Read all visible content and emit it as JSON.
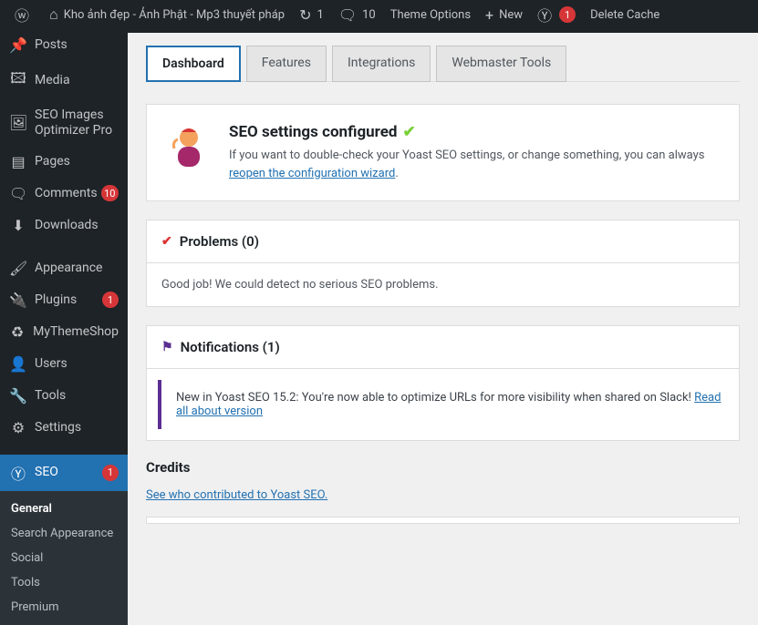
{
  "topbar": {
    "site_name": "Kho ảnh đẹp - Ảnh Phật - Mp3 thuyết pháp",
    "updates": "1",
    "comments": "10",
    "theme_options": "Theme Options",
    "new": "New",
    "yoast_badge": "1",
    "delete_cache": "Delete Cache"
  },
  "sidebar": {
    "posts": "Posts",
    "media": "Media",
    "seo_images": "SEO Images Optimizer Pro",
    "pages": "Pages",
    "comments": "Comments",
    "comments_count": "10",
    "downloads": "Downloads",
    "appearance": "Appearance",
    "plugins": "Plugins",
    "plugins_count": "1",
    "mythemeshop": "MyThemeShop",
    "users": "Users",
    "tools": "Tools",
    "settings": "Settings",
    "seo": "SEO",
    "seo_count": "1",
    "sub": {
      "general": "General",
      "search_appearance": "Search Appearance",
      "social": "Social",
      "tools": "Tools",
      "premium": "Premium"
    }
  },
  "tabs": {
    "dashboard": "Dashboard",
    "features": "Features",
    "integrations": "Integrations",
    "webmaster": "Webmaster Tools"
  },
  "intro": {
    "title": "SEO settings configured",
    "text_before": "If you want to double-check your Yoast SEO settings, or change something, you can always ",
    "link": "reopen the configuration wizard",
    "text_after": "."
  },
  "problems": {
    "title": "Problems (0)",
    "body": "Good job! We could detect no serious SEO problems."
  },
  "notifications": {
    "title": "Notifications (1)",
    "item_before": "New in Yoast SEO 15.2: You're now able to optimize URLs for more visibility when shared on Slack! ",
    "item_link": "Read all about version"
  },
  "credits": {
    "title": "Credits",
    "link": "See who contributed to Yoast SEO."
  }
}
